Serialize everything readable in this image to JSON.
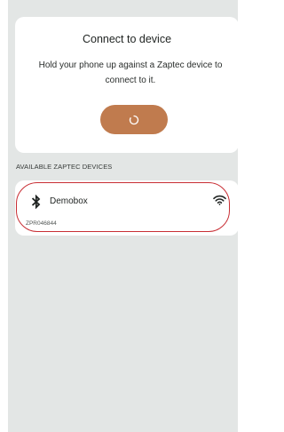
{
  "connect_card": {
    "title": "Connect to device",
    "instructions": "Hold your phone up against a Zaptec device to connect to it.",
    "button_icon": "loading-spinner-icon"
  },
  "devices_section": {
    "header": "AVAILABLE ZAPTEC DEVICES",
    "devices": [
      {
        "name": "Demobox",
        "serial": "ZPR046844",
        "connection_icon": "bluetooth-icon",
        "signal_icon": "wifi-signal-icon"
      }
    ]
  },
  "colors": {
    "background": "#e3e6e5",
    "card": "#ffffff",
    "accent": "#c07b4e",
    "highlight": "#c82e34"
  }
}
